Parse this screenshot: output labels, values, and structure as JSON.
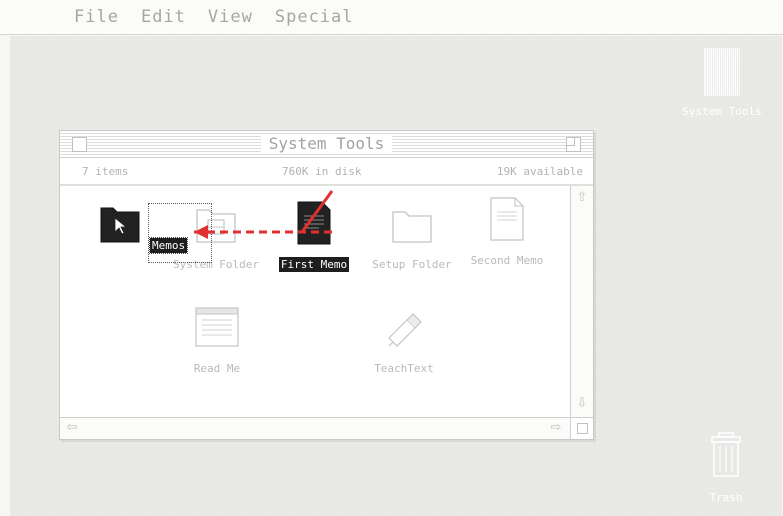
{
  "menubar": {
    "apple_glyph": "",
    "menus": [
      "File",
      "Edit",
      "View",
      "Special"
    ]
  },
  "desktop": {
    "drive_label": "System Tools",
    "trash_label": "Trash"
  },
  "window": {
    "title": "System Tools",
    "info": {
      "items": "7 items",
      "disk": "760K in disk",
      "available": "19K available"
    },
    "icons": [
      {
        "label": "Memos",
        "kind": "folder",
        "selected": true
      },
      {
        "label": "System Folder",
        "kind": "system-folder",
        "selected": false
      },
      {
        "label": "First Memo",
        "kind": "document",
        "selected": true
      },
      {
        "label": "Setup Folder",
        "kind": "folder",
        "selected": false
      },
      {
        "label": "Second Memo",
        "kind": "document",
        "selected": false
      },
      {
        "label": "Read Me",
        "kind": "readme",
        "selected": false
      },
      {
        "label": "TeachText",
        "kind": "application",
        "selected": false
      }
    ]
  },
  "annotation": {
    "arrow_color": "#e03030",
    "action": "drag First Memo into Memos folder"
  }
}
